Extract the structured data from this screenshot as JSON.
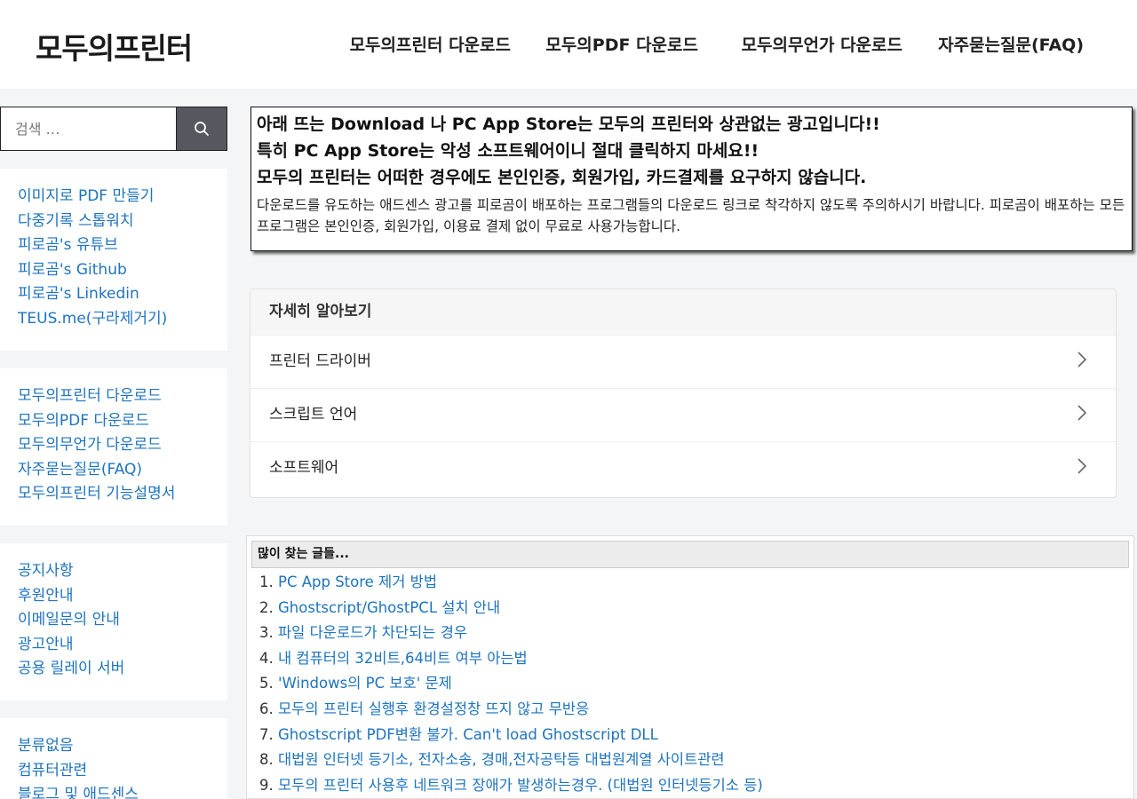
{
  "header": {
    "logo": "모두의프린터",
    "nav": [
      {
        "label": "모두의프린터 다운로드"
      },
      {
        "label": "모두의PDF 다운로드"
      },
      {
        "label": "모두의무언가 다운로드"
      },
      {
        "label": "자주묻는질문(FAQ)"
      }
    ]
  },
  "search": {
    "placeholder": "검색 …",
    "button_icon": "search-icon"
  },
  "sidebar": {
    "widget1": [
      "이미지로 PDF 만들기",
      "다중기록 스톱워치",
      "피로곰's 유튜브",
      "피로곰's Github",
      "피로곰's Linkedin",
      "TEUS.me(구라제거기)"
    ],
    "widget2": [
      "모두의프린터 다운로드",
      "모두의PDF 다운로드",
      "모두의무언가 다운로드",
      "자주묻는질문(FAQ)",
      "모두의프린터 기능설명서"
    ],
    "widget3": [
      "공지사항",
      "후원안내",
      "이메일문의 안내",
      "광고안내",
      "공용 릴레이 서버"
    ],
    "widget4": [
      "분류없음",
      "컴퓨터관련",
      "블로그 및 애드센스"
    ]
  },
  "notice": {
    "line1": "아래 뜨는 Download 나 PC App Store는 모두의 프린터와 상관없는 광고입니다!!",
    "line2": "특히 PC App Store는 악성 소프트웨어이니 절대 클릭하지 마세요!!",
    "line3": "모두의 프린터는 어떠한 경우에도 본인인증, 회원가입, 카드결제를 요구하지 않습니다.",
    "body": "다운로드를 유도하는 애드센스 광고를 피로곰이 배포하는 프로그램들의 다운로드 링크로 착각하지 않도록 주의하시기 바랍니다. 피로곰이 배포하는 모든 프로그램은 본인인증, 회원가입, 이용료 결제 없이 무료로 사용가능합니다."
  },
  "learn_more": {
    "title": "자세히 알아보기",
    "items": [
      {
        "label": "프린터 드라이버"
      },
      {
        "label": "스크립트 언어"
      },
      {
        "label": "소프트웨어"
      }
    ]
  },
  "popular": {
    "title": "많이 찾는 글들...",
    "items": [
      {
        "num": "1.",
        "text": "PC App Store 제거 방법"
      },
      {
        "num": "2.",
        "text": "Ghostscript/GhostPCL 설치 안내"
      },
      {
        "num": "3.",
        "text": "파일 다운로드가 차단되는 경우"
      },
      {
        "num": "4.",
        "text": "내 컴퓨터의 32비트,64비트 여부 아는법"
      },
      {
        "num": "5.",
        "text": "'Windows의 PC 보호' 문제"
      },
      {
        "num": "6.",
        "text": "모두의 프린터 실행후 환경설정창 뜨지 않고 무반응"
      },
      {
        "num": "7.",
        "text": "Ghostscript PDF변환 불가. Can't load Ghostscript DLL"
      },
      {
        "num": "8.",
        "text": "대법원 인터넷 등기소, 전자소송, 경매,전자공탁등 대법원계열 사이트관련"
      },
      {
        "num": "9.",
        "text": "모두의 프린터 사용후 네트워크 장애가 발생하는경우. (대법원 인터넷등기소 등)"
      }
    ]
  },
  "colors": {
    "link": "#1e73be",
    "search_button": "#55585e",
    "background": "#f4f5f7"
  }
}
